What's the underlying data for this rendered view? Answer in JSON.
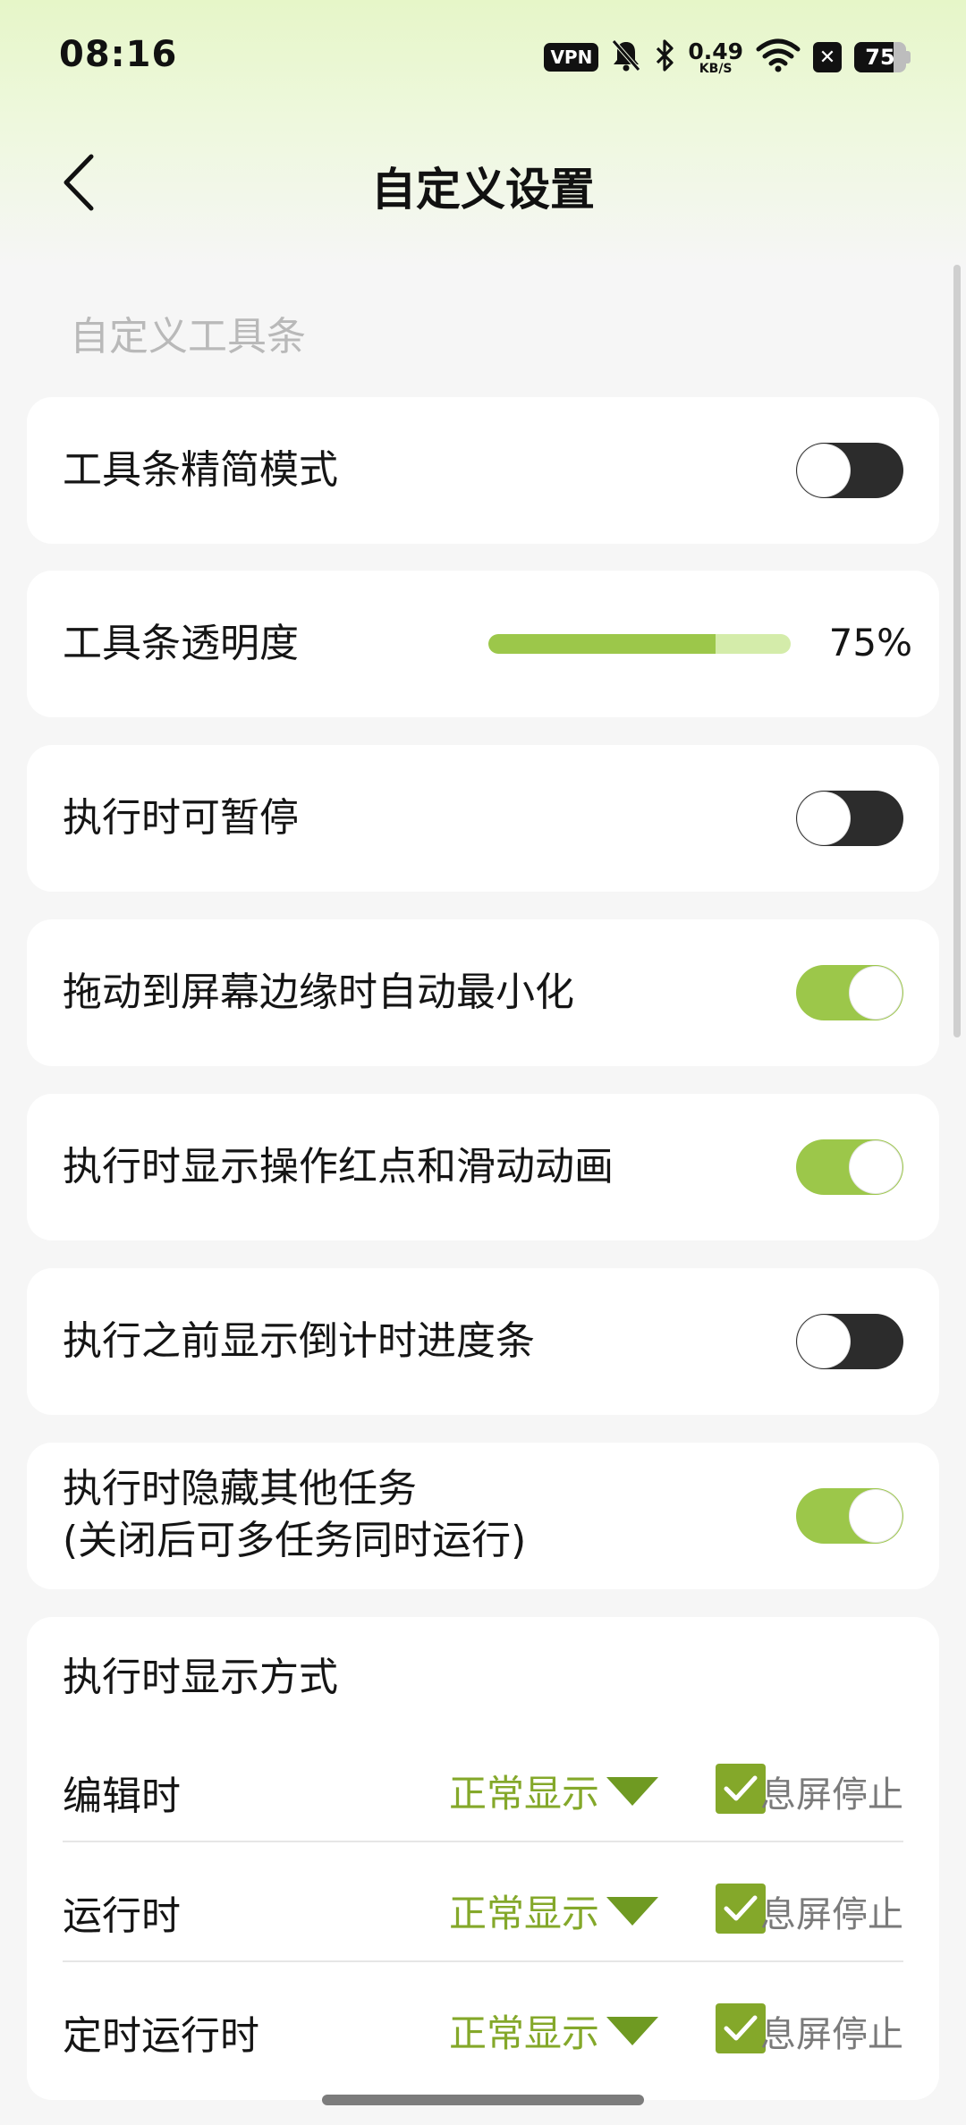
{
  "status_bar": {
    "time": "08:16",
    "vpn": "VPN",
    "net_speed_value": "0.49",
    "net_speed_unit": "KB/S",
    "battery_level": "75",
    "battery_fraction": 0.75,
    "icons": [
      "vpn-icon",
      "bell-off-icon",
      "bluetooth-icon",
      "wifi-icon",
      "close-box-icon",
      "battery-icon"
    ]
  },
  "header": {
    "title": "自定义设置",
    "back_icon": "back-chevron-icon"
  },
  "section": {
    "title": "自定义工具条"
  },
  "settings": {
    "compact_mode": {
      "label": "工具条精简模式",
      "on": false
    },
    "transparency": {
      "label": "工具条透明度",
      "value": 75,
      "value_text": "75%"
    },
    "pausable": {
      "label": "执行时可暂停",
      "on": false
    },
    "auto_minimize": {
      "label": "拖动到屏幕边缘时自动最小化",
      "on": true
    },
    "show_red_dot": {
      "label": "执行时显示操作红点和滑动动画",
      "on": true
    },
    "countdown": {
      "label": "执行之前显示倒计时进度条",
      "on": false
    },
    "hide_tasks": {
      "label_line1": "执行时隐藏其他任务",
      "label_line2": "(关闭后可多任务同时运行)",
      "on": true
    }
  },
  "display_mode": {
    "title": "执行时显示方式",
    "rows": [
      {
        "label": "编辑时",
        "mode": "正常显示",
        "checked": true,
        "check_label": "息屏停止"
      },
      {
        "label": "运行时",
        "mode": "正常显示",
        "checked": true,
        "check_label": "息屏停止"
      },
      {
        "label": "定时运行时",
        "mode": "正常显示",
        "checked": true,
        "check_label": "息屏停止"
      }
    ]
  },
  "colors": {
    "accent": "#9cc74a",
    "accent_dark": "#84a82a",
    "toggle_off": "#2c2c2c",
    "background": "#f6f6f6"
  }
}
